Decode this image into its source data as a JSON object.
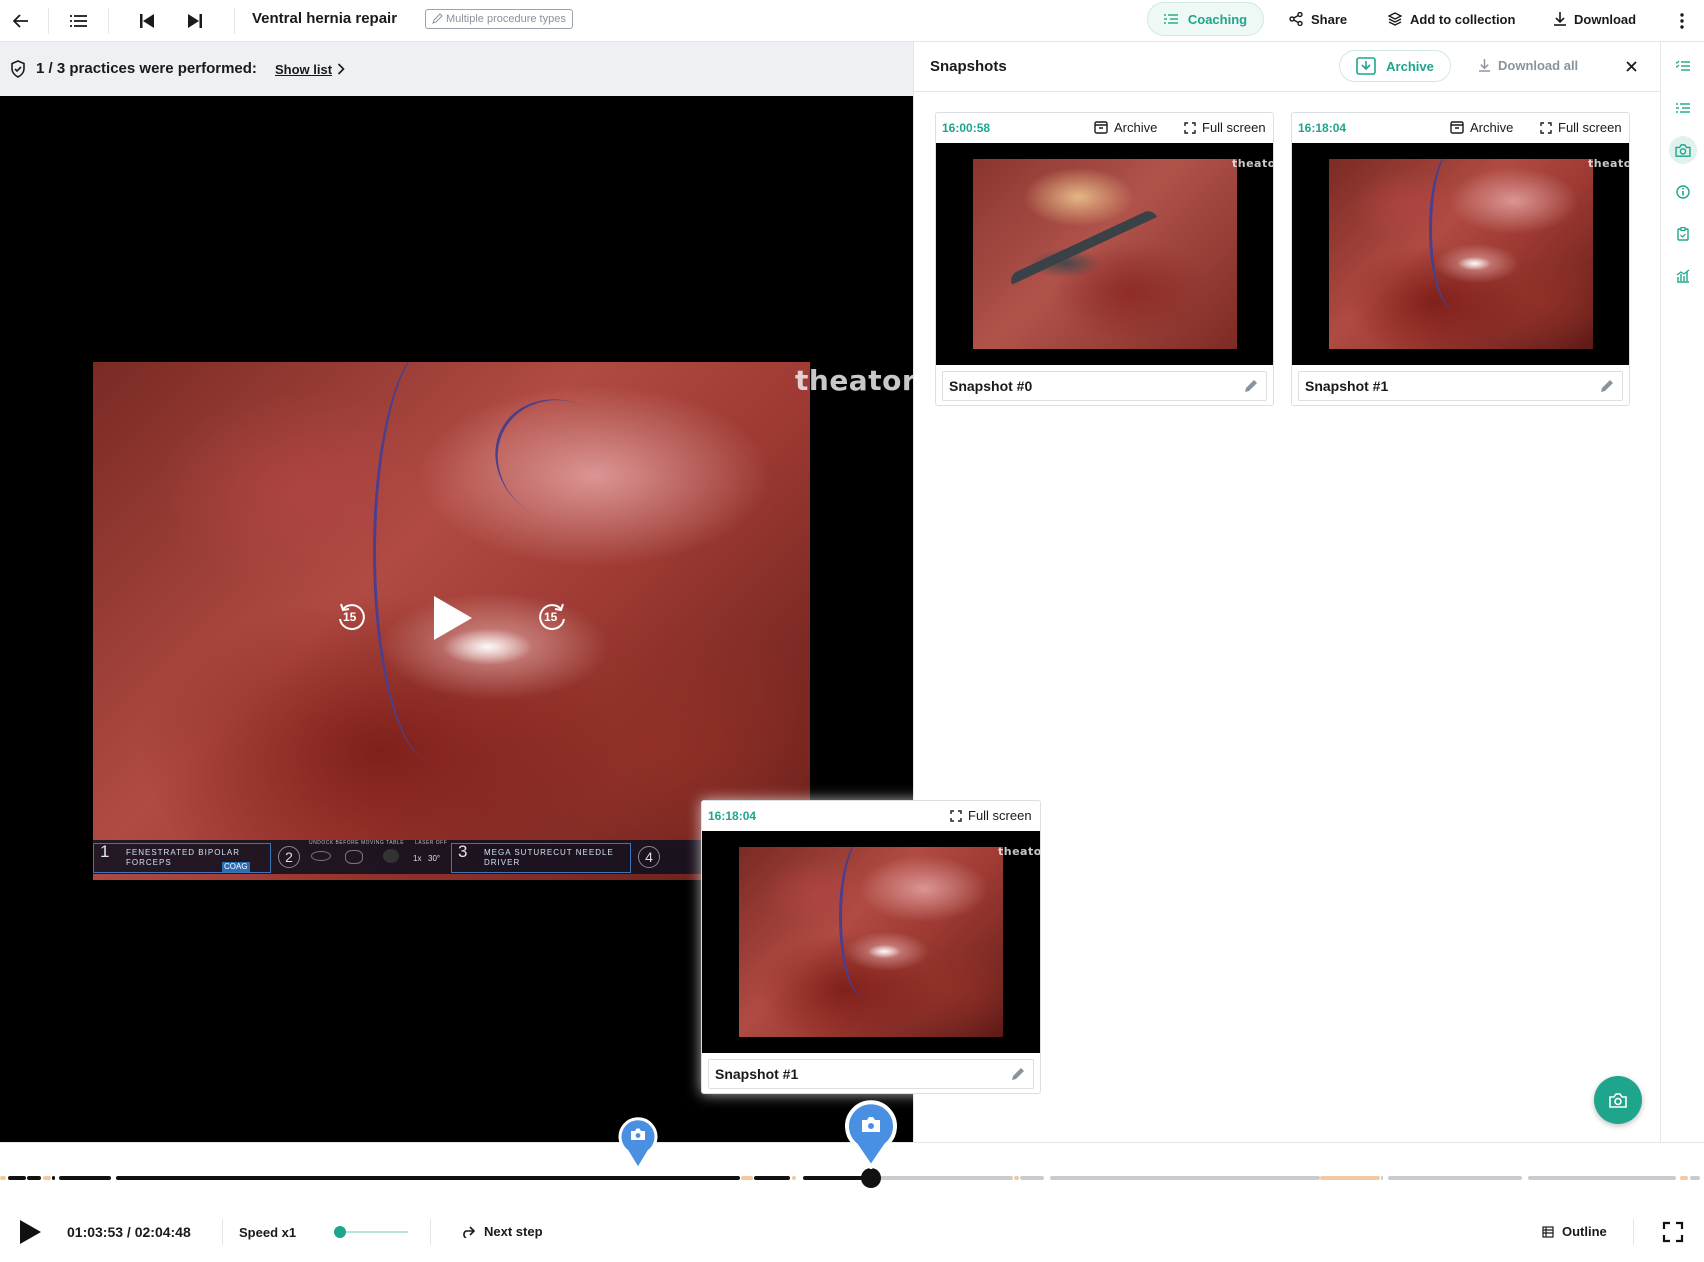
{
  "topbar": {
    "title": "Ventral hernia repair",
    "procedure_badge": "Multiple procedure types",
    "coaching_label": "Coaching",
    "share_label": "Share",
    "add_collection_label": "Add to collection",
    "download_label": "Download"
  },
  "practices": {
    "text": "1 / 3 practices were performed:",
    "link": "Show list"
  },
  "video": {
    "watermark": "theator",
    "skip_back": "15",
    "skip_forward": "15",
    "overlay": {
      "tool1_num": "1",
      "tool1_label": "FENESTRATED BIPOLAR FORCEPS",
      "tool1_mode": "COAG",
      "slot2": "2",
      "status_top": "UNDOCK BEFORE MOVING TABLE",
      "status_laser": "LASER OFF",
      "zoom": "1x",
      "angle": "30°",
      "tool3_num": "3",
      "tool3_label": "MEGA SUTURECUT NEEDLE DRIVER",
      "slot4": "4"
    }
  },
  "panel": {
    "title": "Snapshots",
    "archive_label": "Archive",
    "download_all_label": "Download all"
  },
  "snapshots": [
    {
      "time": "16:00:58",
      "archive": "Archive",
      "fullscreen": "Full screen",
      "name": "Snapshot #0"
    },
    {
      "time": "16:18:04",
      "archive": "Archive",
      "fullscreen": "Full screen",
      "name": "Snapshot #1"
    }
  ],
  "popup": {
    "time": "16:18:04",
    "fullscreen": "Full screen",
    "name": "Snapshot #1"
  },
  "controls": {
    "time": "01:03:53 / 02:04:48",
    "speed": "Speed x1",
    "speed_level": 0.08,
    "progress": 0.511,
    "next_step": "Next step",
    "outline": "Outline"
  },
  "colors": {
    "accent": "#1fa58b",
    "pin_blue": "#4a90e2",
    "track_dark": "#111111",
    "track_light": "#c8ccd0",
    "segment_marker": "#f3c9a0"
  }
}
